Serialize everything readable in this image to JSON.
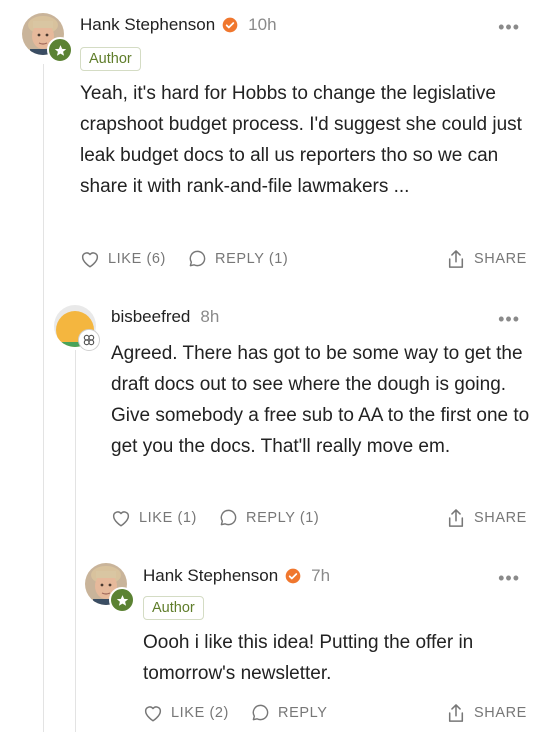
{
  "comments": [
    {
      "author": "Hank Stephenson",
      "time": "10h",
      "tag": "Author",
      "text": "Yeah, it's hard for Hobbs to change the legislative crapshoot budget process. I'd suggest she could just leak budget docs to all us reporters tho so we can share it with rank-and-file lawmakers ...",
      "like_label": "LIKE (6)",
      "reply_label": "REPLY (1)",
      "share_label": "SHARE",
      "more": "•••"
    },
    {
      "author": "bisbeefred",
      "time": "8h",
      "text": "Agreed. There has got to be some way to get the draft docs out to see where the dough is going. Give somebody a free sub to AA to the first one to get you the docs. That'll really move em.",
      "like_label": "LIKE (1)",
      "reply_label": "REPLY (1)",
      "share_label": "SHARE",
      "more": "•••"
    },
    {
      "author": "Hank Stephenson",
      "time": "7h",
      "tag": "Author",
      "text": "Oooh i like this idea! Putting the offer in tomorrow's newsletter.",
      "like_label": "LIKE (2)",
      "reply_label": "REPLY",
      "share_label": "SHARE",
      "more": "•••"
    }
  ],
  "colors": {
    "verified": "#f0772e",
    "author_tag_text": "#5f7d2a",
    "star_badge": "#5b8233",
    "thread_line": "#e3e3e3"
  }
}
